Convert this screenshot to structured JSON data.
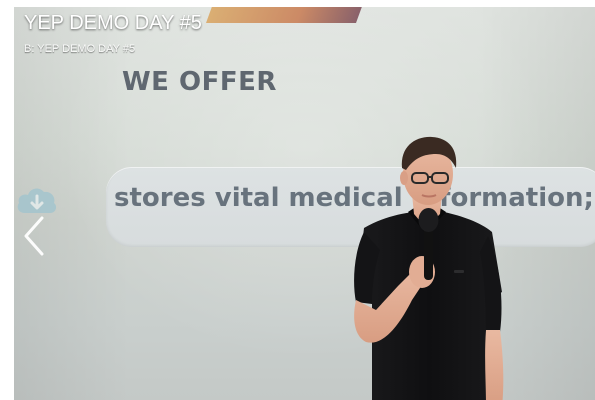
{
  "viewer": {
    "title": "YEP DEMO DAY #5",
    "subtitle": "B: YEP DEMO DAY #5"
  },
  "slide": {
    "heading": "WE OFFER",
    "line": "stores vital medical information;"
  },
  "icons": {
    "prev": "chevron-left-icon",
    "cloud": "cloud-download-icon"
  },
  "colors": {
    "slide_text": "#68737d",
    "heading_text": "#5f6770",
    "shirt": "#151515"
  }
}
